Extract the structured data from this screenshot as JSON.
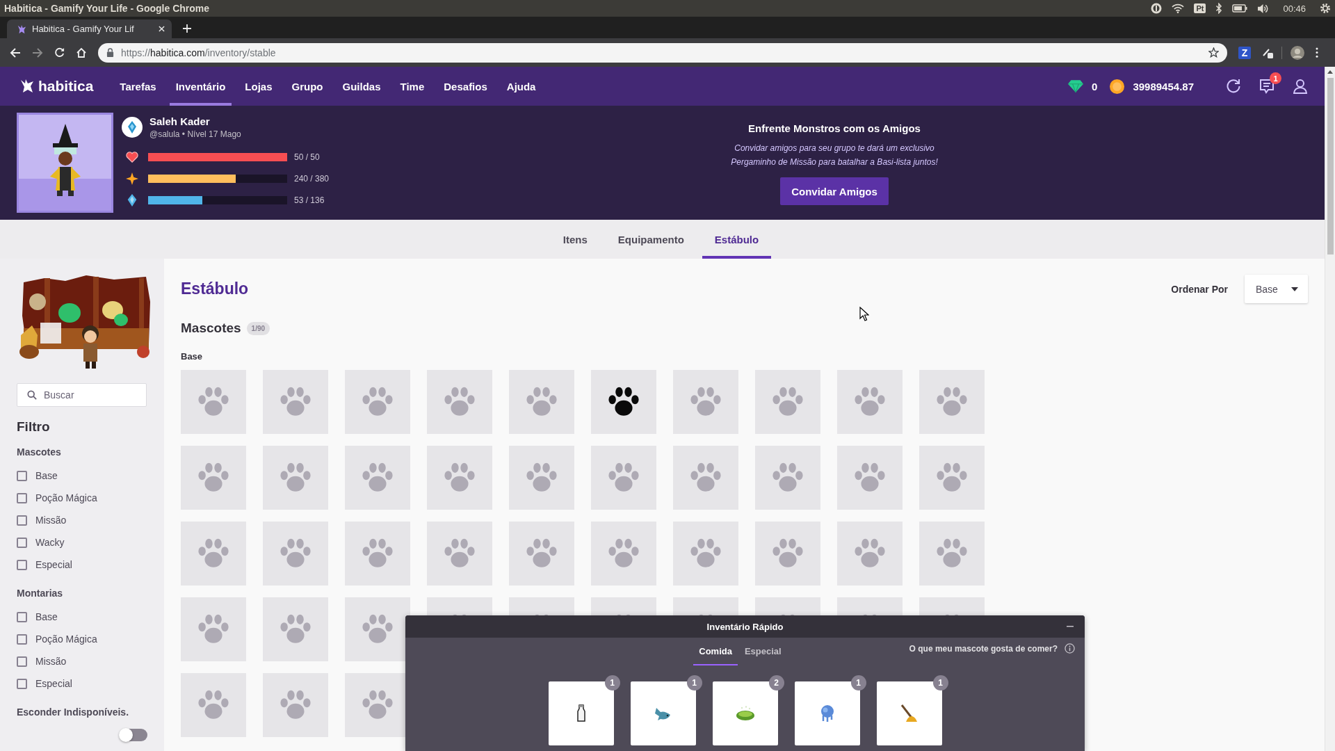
{
  "system_bar": {
    "title": "Habitica - Gamify Your Life - Google Chrome",
    "keyboard_layout": "Pt",
    "clock": "00:46"
  },
  "browser": {
    "tab_title": "Habitica - Gamify Your Lif",
    "url_scheme": "https://",
    "url_host": "habitica.com",
    "url_path": "/inventory/stable",
    "extension_letter": "Z"
  },
  "nav": {
    "logo": "habitica",
    "items": [
      {
        "label": "Tarefas",
        "selected": false
      },
      {
        "label": "Inventário",
        "selected": true
      },
      {
        "label": "Lojas",
        "selected": false
      },
      {
        "label": "Grupo",
        "selected": false
      },
      {
        "label": "Guildas",
        "selected": false
      },
      {
        "label": "Time",
        "selected": false
      },
      {
        "label": "Desafios",
        "selected": false
      },
      {
        "label": "Ajuda",
        "selected": false
      }
    ],
    "gems": "0",
    "gold": "39989454.87",
    "notifications": "1"
  },
  "profile": {
    "name": "Saleh Kader",
    "subtitle": "@salula • Nível 17 Mago",
    "stats": [
      {
        "kind": "health",
        "level": 1,
        "reading": "50 / 50"
      },
      {
        "kind": "experience",
        "level": 0.632,
        "reading": "240 / 380"
      },
      {
        "kind": "mana",
        "level": 0.39,
        "reading": "53 / 136"
      }
    ]
  },
  "party_promo": {
    "title": "Enfrente Monstros com os Amigos",
    "text": "Convidar amigos para seu grupo te dará um exclusivo Pergaminho de Missão para batalhar a Basi-lista juntos!",
    "button": "Convidar Amigos"
  },
  "tabs": [
    {
      "label": "Itens",
      "selected": false
    },
    {
      "label": "Equipamento",
      "selected": false
    },
    {
      "label": "Estábulo",
      "selected": true
    }
  ],
  "sidebar": {
    "search": {
      "placeholder": "Buscar"
    },
    "filter_title": "Filtro",
    "groups": [
      {
        "title": "Mascotes",
        "options": [
          {
            "label": "Base",
            "checked": false
          },
          {
            "label": "Poção Mágica",
            "checked": false
          },
          {
            "label": "Missão",
            "checked": false
          },
          {
            "label": "Wacky",
            "checked": false
          },
          {
            "label": "Especial",
            "checked": false
          }
        ]
      },
      {
        "title": "Montarias",
        "options": [
          {
            "label": "Base",
            "checked": false
          },
          {
            "label": "Poção Mágica",
            "checked": false
          },
          {
            "label": "Missão",
            "checked": false
          },
          {
            "label": "Especial",
            "checked": false
          }
        ]
      }
    ],
    "hide_unavailable": {
      "label": "Esconder Indisponíveis.",
      "on": false
    }
  },
  "stable": {
    "title": "Estábulo",
    "sort": {
      "label": "Ordenar Por",
      "value": "Base"
    },
    "section": {
      "title": "Mascotes",
      "count": "1/90"
    },
    "group_title": "Base",
    "pets": [
      {
        "highlighted": false
      },
      {
        "highlighted": false
      },
      {
        "highlighted": false
      },
      {
        "highlighted": false
      },
      {
        "highlighted": false
      },
      {
        "highlighted": true
      },
      {
        "highlighted": false
      },
      {
        "highlighted": false
      },
      {
        "highlighted": false
      },
      {
        "highlighted": false
      },
      {
        "highlighted": false
      },
      {
        "highlighted": false
      },
      {
        "highlighted": false
      },
      {
        "highlighted": false
      },
      {
        "highlighted": false
      },
      {
        "highlighted": false
      },
      {
        "highlighted": false
      },
      {
        "highlighted": false
      },
      {
        "highlighted": false
      },
      {
        "highlighted": false
      },
      {
        "highlighted": false
      },
      {
        "highlighted": false
      },
      {
        "highlighted": false
      },
      {
        "highlighted": false
      },
      {
        "highlighted": false
      },
      {
        "highlighted": false
      },
      {
        "highlighted": false
      },
      {
        "highlighted": false
      },
      {
        "highlighted": false
      },
      {
        "highlighted": false
      },
      {
        "highlighted": false
      },
      {
        "highlighted": false
      },
      {
        "highlighted": false
      },
      {
        "highlighted": false
      },
      {
        "highlighted": false
      },
      {
        "highlighted": false
      },
      {
        "highlighted": false
      },
      {
        "highlighted": false
      },
      {
        "highlighted": false
      },
      {
        "highlighted": false
      },
      {
        "highlighted": false
      },
      {
        "highlighted": false
      },
      {
        "highlighted": false
      }
    ]
  },
  "quick_inventory": {
    "title": "Inventário Rápido",
    "tabs": [
      {
        "label": "Comida",
        "selected": true
      },
      {
        "label": "Especial",
        "selected": false
      }
    ],
    "hint": "O que meu mascote gosta de comer?",
    "items": [
      {
        "kind": "bottle",
        "count": "1"
      },
      {
        "kind": "fish",
        "count": "1"
      },
      {
        "kind": "dish",
        "count": "2"
      },
      {
        "kind": "puff",
        "count": "1"
      },
      {
        "kind": "dipper",
        "count": "1"
      }
    ]
  }
}
